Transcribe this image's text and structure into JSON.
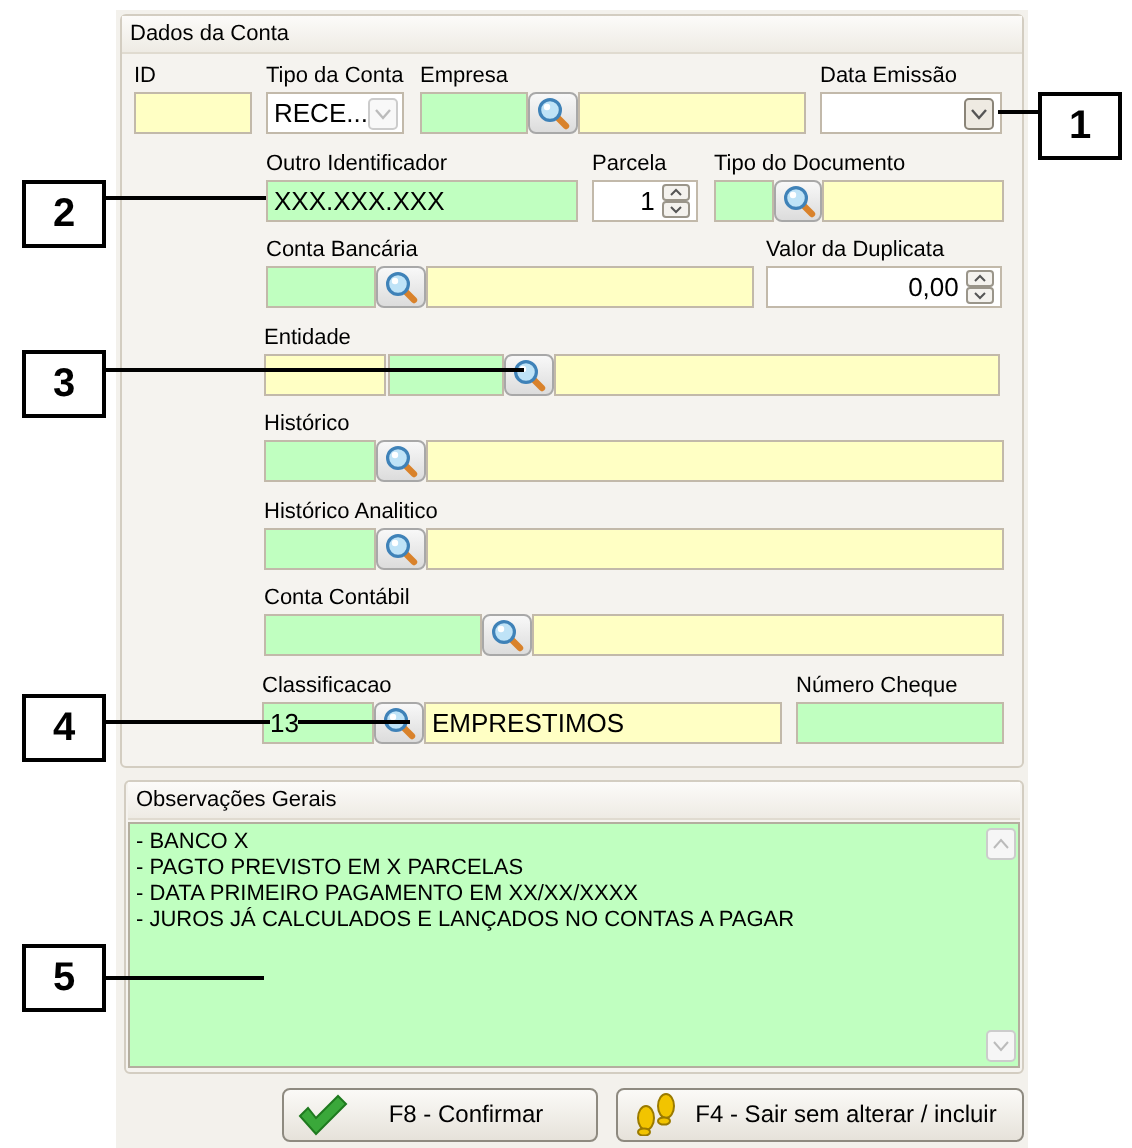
{
  "account": {
    "title": "Dados da Conta",
    "rows": [
      {
        "fields": [
          {
            "label": "ID",
            "kind": "text"
          },
          {
            "label": "Tipo da Conta",
            "kind": "select",
            "value": "RECE..."
          },
          {
            "label": "Empresa",
            "kind": "lookup"
          },
          {
            "label": "Data Emissão",
            "kind": "date"
          }
        ]
      },
      {
        "fields": [
          {
            "label": "Outro Identificador",
            "kind": "key",
            "value": "XXX.XXX.XXX"
          },
          {
            "label": "Parcela",
            "kind": "spin",
            "value": "1"
          },
          {
            "label": "Tipo do Documento",
            "kind": "lookup"
          }
        ]
      },
      {
        "fields": [
          {
            "label": "Conta Bancária",
            "kind": "lookup"
          },
          {
            "label": "Valor da Duplicata",
            "kind": "spin",
            "value": "0,00"
          }
        ]
      },
      {
        "fields": [
          {
            "label": "Entidade",
            "kind": "double_lookup"
          }
        ]
      },
      {
        "fields": [
          {
            "label": "Histórico",
            "kind": "lookup"
          }
        ]
      },
      {
        "fields": [
          {
            "label": "Histórico Analitico",
            "kind": "lookup"
          }
        ]
      },
      {
        "fields": [
          {
            "label": "Conta Contábil",
            "kind": "lookup"
          }
        ]
      },
      {
        "fields": [
          {
            "label": "Classificacao",
            "kind": "lookup",
            "code": "13",
            "description": "EMPRESTIMOS"
          },
          {
            "label": "Número Cheque",
            "kind": "key"
          }
        ]
      }
    ]
  },
  "notes": {
    "title": "Observações Gerais",
    "lines": [
      "- BANCO X",
      "- PAGTO PREVISTO EM X PARCELAS",
      "- DATA PRIMEIRO PAGAMENTO EM XX/XX/XXXX",
      "- JUROS JÁ CALCULADOS E LANÇADOS NO CONTAS A PAGAR"
    ]
  },
  "buttons": [
    {
      "label": "F8 - Confirmar",
      "kind": "confirm"
    },
    {
      "label": "F4 - Sair sem alterar / incluir",
      "kind": "exit"
    }
  ],
  "callouts": [
    {
      "number": "1"
    },
    {
      "number": "2"
    },
    {
      "number": "3"
    },
    {
      "number": "4"
    },
    {
      "number": "5"
    }
  ]
}
